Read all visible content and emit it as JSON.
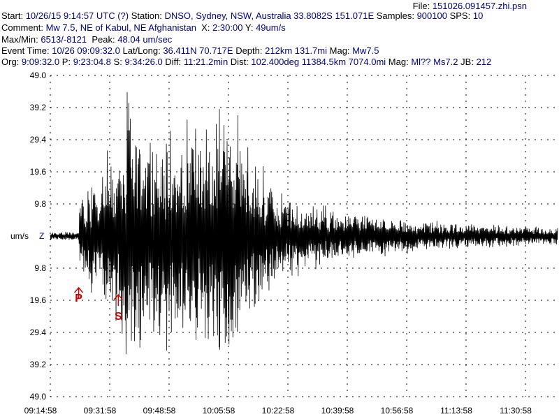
{
  "header": {
    "file_label": "File:",
    "file": "151026.091457.zhi.psn",
    "line1": {
      "start_label": "Start:",
      "start": "10/26/15  9:14:57 UTC (?)",
      "station_label": "Station:",
      "station": "DNSO, Sydney, NSW, Australia 33.8082S 151.071E",
      "samples_label": "Samples:",
      "samples": "900100",
      "sps_label": "SPS:",
      "sps": "10"
    },
    "line2": {
      "comment_label": "Comment:",
      "comment": "Mw 7.5, NE of Kabul, NE Afghanistan",
      "x_label": "X:",
      "x": "2:30:00",
      "y_label": "Y:",
      "y": "49um/s"
    },
    "line3": {
      "maxmin_label": "Max/Min:",
      "maxmin": "6513/-8121",
      "peak_label": "Peak:",
      "peak": "48.04 um/sec"
    },
    "line4": {
      "event_label": "Event Time:",
      "event": "10/26 09:09:32.0",
      "latlong_label": "Lat/Long:",
      "latlong": "36.411N 70.717E",
      "depth_label": "Depth:",
      "depth": "212km 131.7mi",
      "mag_label": "Mag:",
      "mag": "Mw7.5"
    },
    "line5": {
      "org_label": "Org:",
      "org": "9:09:32.0",
      "p_label": "P:",
      "p": "9:23:04.8",
      "s_label": "S:",
      "s": "9:34:26.0",
      "diff_label": "Diff:",
      "diff": "11:21.2min",
      "dist_label": "Dist:",
      "dist": "102.400deg 11384.5km 7074.0mi",
      "mag_label": "Mag:",
      "mag": "Ml?? Ms7.2",
      "jb_label": "JB:",
      "jb": "212"
    }
  },
  "chart_data": {
    "type": "line",
    "units_label": "um/s",
    "channel_label": "Z",
    "ylim": [
      -49.0,
      49.0
    ],
    "y_ticks": [
      {
        "label": "49.0",
        "value": 49.0
      },
      {
        "label": "39.2",
        "value": 39.2
      },
      {
        "label": "29.4",
        "value": 29.4
      },
      {
        "label": "19.6",
        "value": 19.6
      },
      {
        "label": "9.8",
        "value": 9.8
      },
      {
        "label": "9.8",
        "value": -9.8
      },
      {
        "label": "19.6",
        "value": -19.6
      },
      {
        "label": "29.4",
        "value": -29.4
      },
      {
        "label": "39.2",
        "value": -39.2
      },
      {
        "label": "49.0",
        "value": -49.0
      }
    ],
    "x_range_seconds": 9000,
    "x_ticks": [
      "09:14:58",
      "09:31:58",
      "09:48:58",
      "10:05:58",
      "10:22:58",
      "10:39:58",
      "10:56:58",
      "11:13:58",
      "11:30:58"
    ],
    "grid": true,
    "markers": [
      {
        "label": "P",
        "time": "09:23:04.8"
      },
      {
        "label": "S",
        "time": "09:34:26.0"
      }
    ],
    "envelope": [
      {
        "time": "09:14:58",
        "amplitude": 1.2
      },
      {
        "time": "09:23:04",
        "amplitude": 1.5
      },
      {
        "time": "09:23:30",
        "amplitude": 12
      },
      {
        "time": "09:28:00",
        "amplitude": 18
      },
      {
        "time": "09:34:26",
        "amplitude": 28
      },
      {
        "time": "09:38:00",
        "amplitude": 44
      },
      {
        "time": "09:48:58",
        "amplitude": 30
      },
      {
        "time": "09:58:00",
        "amplitude": 38
      },
      {
        "time": "10:05:58",
        "amplitude": 40
      },
      {
        "time": "10:12:00",
        "amplitude": 28
      },
      {
        "time": "10:16:00",
        "amplitude": 20
      },
      {
        "time": "10:22:58",
        "amplitude": 12
      },
      {
        "time": "10:39:58",
        "amplitude": 7
      },
      {
        "time": "10:56:58",
        "amplitude": 5
      },
      {
        "time": "11:13:58",
        "amplitude": 4
      },
      {
        "time": "11:30:58",
        "amplitude": 3
      },
      {
        "time": "11:44:58",
        "amplitude": 3
      }
    ]
  }
}
